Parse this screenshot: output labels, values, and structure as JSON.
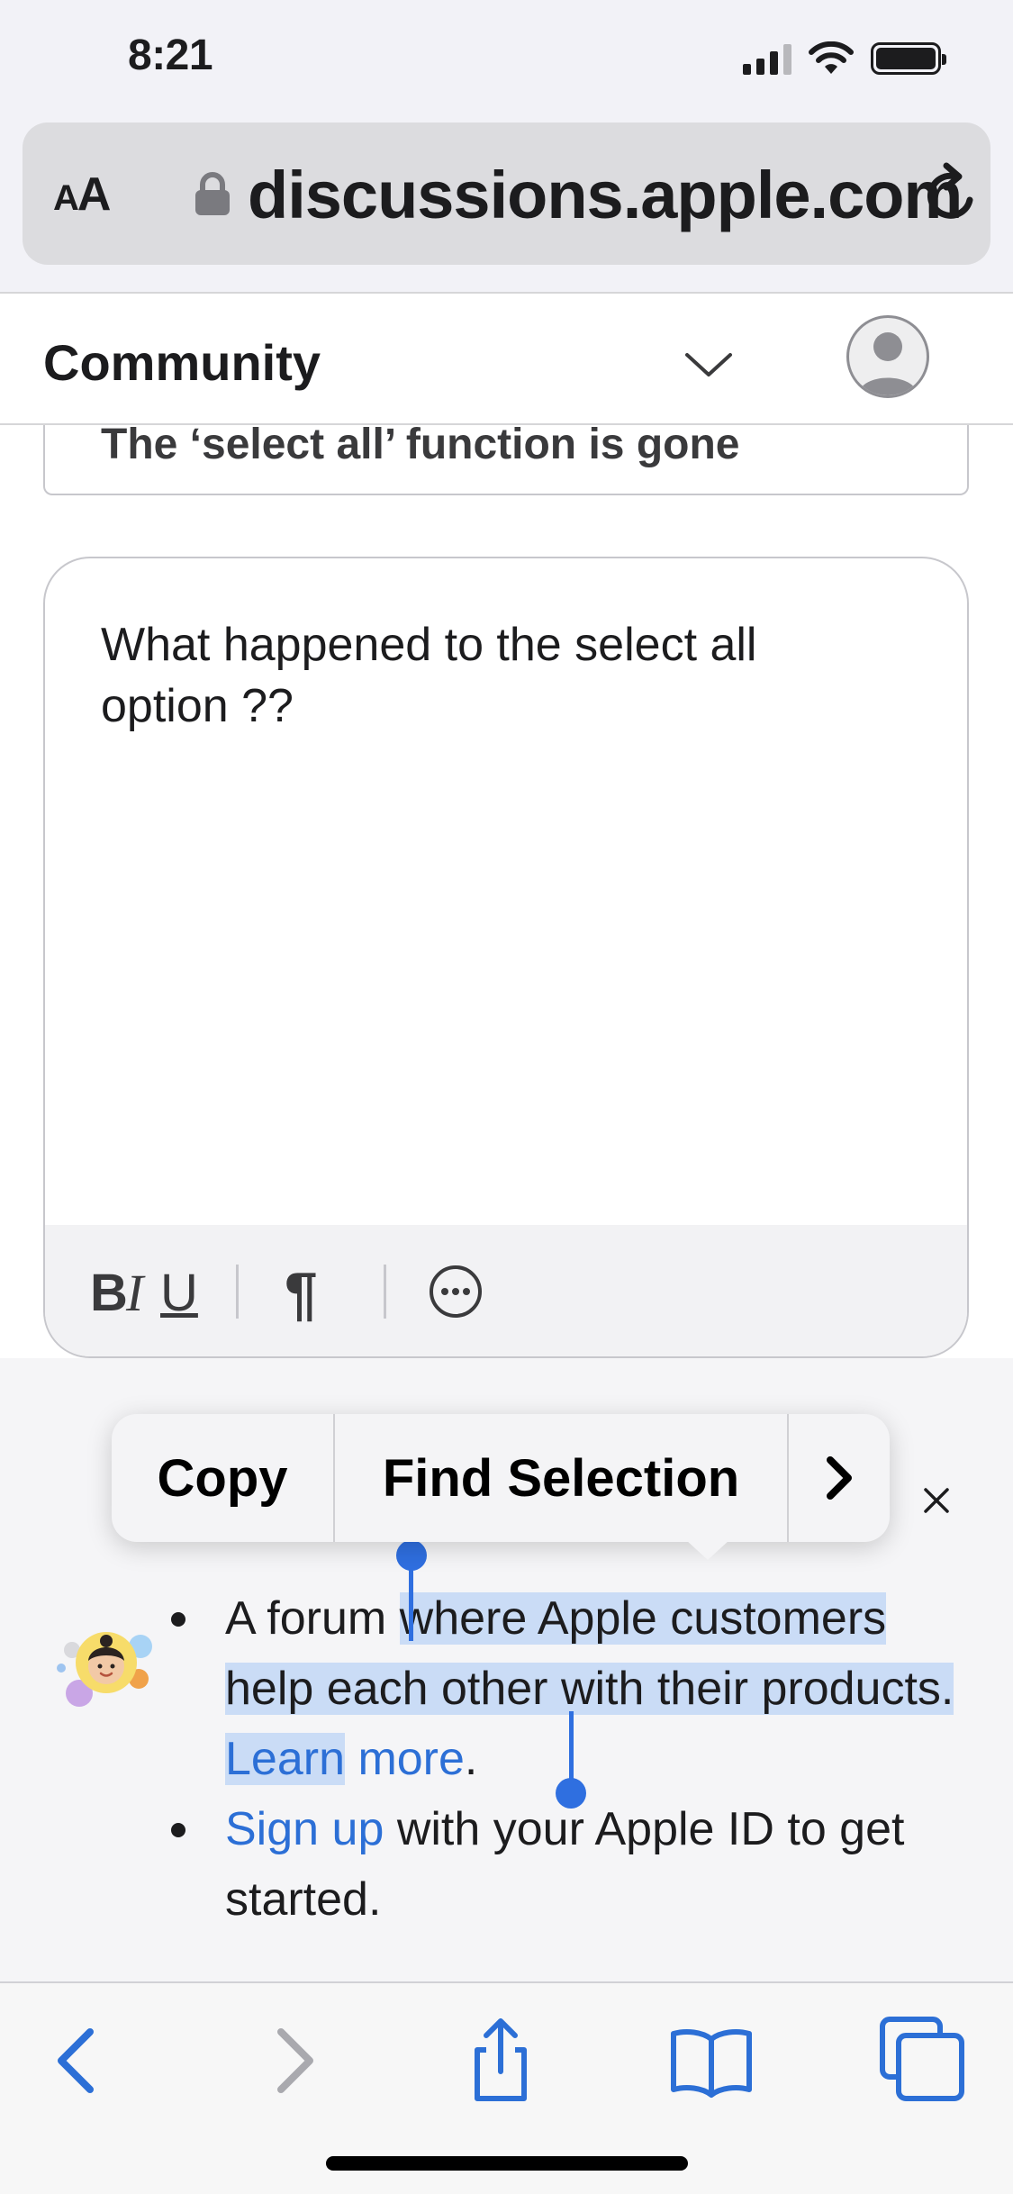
{
  "status_bar": {
    "time": "8:21",
    "icons": [
      "signal-icon",
      "wifi-icon",
      "battery-icon"
    ]
  },
  "address_bar": {
    "aa_label_small": "A",
    "aa_label_large": "A",
    "url": "discussions.apple.com",
    "icons": [
      "lock-icon",
      "reload-icon"
    ]
  },
  "community_header": {
    "title": "Community",
    "icons": [
      "chevron-down-icon",
      "avatar-icon"
    ]
  },
  "form": {
    "subject_value": "The ‘select all’ function is gone",
    "body_value": "What happened to the select all option ??",
    "toolbar": {
      "bold": "B",
      "italic": "I",
      "underline": "U",
      "pilcrow": "¶",
      "icons": [
        "more-options-icon"
      ]
    }
  },
  "context_menu": {
    "copy": "Copy",
    "find_selection": "Find Selection",
    "next": ">"
  },
  "banner": {
    "bullet1": {
      "pre": "A forum ",
      "selected": "where Apple customers help each other with their products. ",
      "link_selected": "Learn",
      "link_rest": " more",
      "post": "."
    },
    "bullet2": {
      "link": "Sign up",
      "rest": " with your Apple ID to get started."
    },
    "icons": [
      "memoji-icon",
      "close-icon"
    ]
  },
  "bottom_toolbar": {
    "icons": [
      "back-icon",
      "forward-icon",
      "share-icon",
      "bookmarks-icon",
      "tabs-icon"
    ],
    "accent": "#2c6fd6",
    "disabled": "#a9a9ae"
  }
}
